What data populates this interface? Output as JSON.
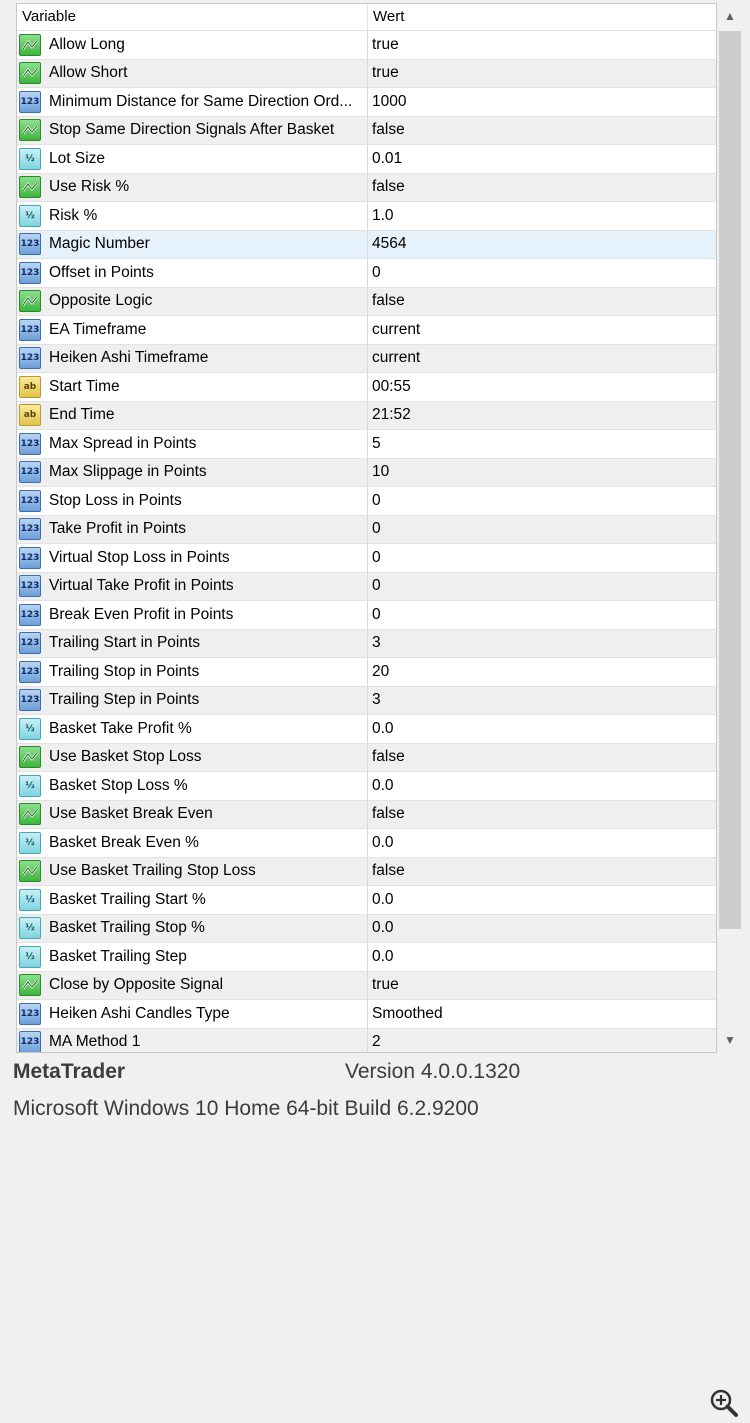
{
  "header": {
    "variable": "Variable",
    "value": "Wert"
  },
  "rows": [
    {
      "type": "bool",
      "name": "Allow Long",
      "value": "true"
    },
    {
      "type": "bool",
      "name": "Allow Short",
      "value": "true"
    },
    {
      "type": "int",
      "name": "Minimum Distance for Same Direction Ord...",
      "value": "1000"
    },
    {
      "type": "bool",
      "name": "Stop Same Direction Signals After Basket",
      "value": "false"
    },
    {
      "type": "double",
      "name": "Lot Size",
      "value": "0.01"
    },
    {
      "type": "bool",
      "name": "Use Risk %",
      "value": "false"
    },
    {
      "type": "double",
      "name": "Risk %",
      "value": "1.0"
    },
    {
      "type": "int",
      "name": "Magic Number",
      "value": "4564"
    },
    {
      "type": "int",
      "name": "Offset in Points",
      "value": "0"
    },
    {
      "type": "bool",
      "name": "Opposite Logic",
      "value": "false"
    },
    {
      "type": "int",
      "name": "EA Timeframe",
      "value": "current"
    },
    {
      "type": "int",
      "name": "Heiken Ashi Timeframe",
      "value": "current"
    },
    {
      "type": "string",
      "name": "Start Time",
      "value": "00:55"
    },
    {
      "type": "string",
      "name": "End Time",
      "value": "21:52"
    },
    {
      "type": "int",
      "name": "Max Spread in Points",
      "value": "5"
    },
    {
      "type": "int",
      "name": "Max Slippage in Points",
      "value": "10"
    },
    {
      "type": "int",
      "name": "Stop Loss in Points",
      "value": "0"
    },
    {
      "type": "int",
      "name": "Take Profit in Points",
      "value": "0"
    },
    {
      "type": "int",
      "name": "Virtual Stop Loss in Points",
      "value": "0"
    },
    {
      "type": "int",
      "name": "Virtual Take Profit in Points",
      "value": "0"
    },
    {
      "type": "int",
      "name": "Break Even Profit in Points",
      "value": "0"
    },
    {
      "type": "int",
      "name": "Trailing Start in Points",
      "value": "3"
    },
    {
      "type": "int",
      "name": "Trailing  Stop in Points",
      "value": "20"
    },
    {
      "type": "int",
      "name": "Trailing Step in Points",
      "value": "3"
    },
    {
      "type": "double",
      "name": "Basket Take Profit %",
      "value": "0.0"
    },
    {
      "type": "bool",
      "name": "Use Basket Stop Loss",
      "value": "false"
    },
    {
      "type": "double",
      "name": "Basket Stop Loss %",
      "value": "0.0"
    },
    {
      "type": "bool",
      "name": "Use Basket Break Even",
      "value": "false"
    },
    {
      "type": "double",
      "name": "Basket Break Even %",
      "value": "0.0"
    },
    {
      "type": "bool",
      "name": "Use Basket Trailing Stop Loss",
      "value": "false"
    },
    {
      "type": "double",
      "name": "Basket Trailing Start %",
      "value": "0.0"
    },
    {
      "type": "double",
      "name": "Basket Trailing Stop %",
      "value": "0.0"
    },
    {
      "type": "double",
      "name": "Basket Trailing Step",
      "value": "0.0"
    },
    {
      "type": "bool",
      "name": "Close by Opposite Signal",
      "value": "true"
    },
    {
      "type": "int",
      "name": "Heiken Ashi Candles Type",
      "value": "Smoothed"
    },
    {
      "type": "int",
      "name": "MA Method 1",
      "value": "2"
    }
  ],
  "selected_row": "Magic Number",
  "footer": {
    "app_name": "MetaTrader",
    "version": "Version 4.0.0.1320",
    "os": "Microsoft Windows 10 Home 64-bit Build 6.2.9200"
  },
  "icons": {
    "bool": "bool-type-icon",
    "int": "int-type-icon",
    "double": "double-type-icon",
    "string": "string-type-icon",
    "zoom": "zoom-in-icon"
  },
  "colors": {
    "selected_row": "#e5f1fb",
    "alt_row": "#efefef",
    "bool_icon": "#3fb43f",
    "int_icon": "#6d9fd8",
    "double_icon": "#7fd3e0",
    "string_icon": "#e3c44a"
  }
}
